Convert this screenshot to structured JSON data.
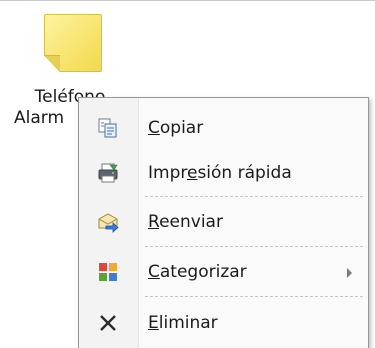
{
  "note": {
    "label_line1": "Teléfono",
    "label_line2": "Alarm",
    "icon": "sticky-note-icon"
  },
  "context_menu": {
    "items": [
      {
        "prefix": "",
        "mnemonic": "C",
        "rest": "opiar",
        "icon": "copy-icon"
      },
      {
        "prefix": "Impr",
        "mnemonic": "e",
        "rest": "sión rápida",
        "icon": "quick-print-icon"
      },
      {
        "prefix": "",
        "mnemonic": "R",
        "rest": "eenviar",
        "icon": "forward-icon"
      },
      {
        "prefix": "",
        "mnemonic": "C",
        "rest": "ategorizar",
        "icon": "categorize-icon",
        "has_submenu": true
      },
      {
        "prefix": "",
        "mnemonic": "E",
        "rest": "liminar",
        "icon": "delete-icon"
      }
    ]
  },
  "colors": {
    "menu_background": "#fafafa",
    "icon_gutter": "#f3f3f3",
    "menu_border": "#979797",
    "separator": "#c5c5c5"
  }
}
